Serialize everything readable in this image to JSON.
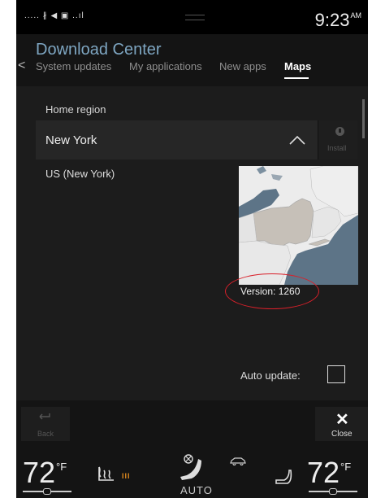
{
  "status_bar": {
    "signal_text": ".....  ∦  ◀  ▣ ..ıl",
    "time": "9:23",
    "ampm": "AM"
  },
  "header": {
    "title": "Download Center",
    "back_glyph": "<",
    "tabs": [
      {
        "label": "System updates",
        "active": false
      },
      {
        "label": "My applications",
        "active": false
      },
      {
        "label": "New apps",
        "active": false
      },
      {
        "label": "Maps",
        "active": true
      }
    ]
  },
  "maps": {
    "home_region_label": "Home region",
    "selected_region": "New York",
    "install_label": "Install",
    "sub_region": "US (New York)",
    "version_label": "Version: 1260",
    "auto_update_label": "Auto update:",
    "auto_update_checked": false
  },
  "bottom_bar": {
    "back_label": "Back",
    "close_label": "Close",
    "close_glyph": "✕"
  },
  "climate": {
    "left_temp": "72",
    "right_temp": "72",
    "unit": "°F",
    "heat_level": "III",
    "auto_label": "AUTO"
  },
  "colors": {
    "title_accent": "#7ea6c2",
    "heat_indicator": "#e08a1e",
    "annotation_ellipse": "#d9202a"
  }
}
